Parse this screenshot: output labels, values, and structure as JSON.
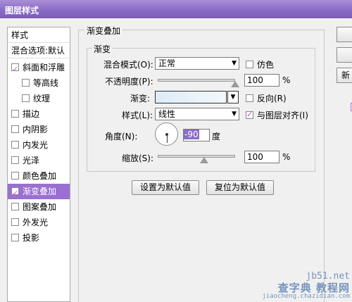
{
  "window": {
    "title": "图层样式"
  },
  "sidebar": {
    "items": [
      {
        "label": "样式",
        "type": "header"
      },
      {
        "label": "混合选项:默认",
        "type": "header"
      },
      {
        "label": "斜面和浮雕",
        "checked": true
      },
      {
        "label": "等高线",
        "checked": false,
        "indent": true
      },
      {
        "label": "纹理",
        "checked": false,
        "indent": true
      },
      {
        "label": "描边",
        "checked": false
      },
      {
        "label": "内阴影",
        "checked": false
      },
      {
        "label": "内发光",
        "checked": false
      },
      {
        "label": "光泽",
        "checked": false
      },
      {
        "label": "颜色叠加",
        "checked": false
      },
      {
        "label": "渐变叠加",
        "checked": true,
        "selected": true
      },
      {
        "label": "图案叠加",
        "checked": false
      },
      {
        "label": "外发光",
        "checked": false
      },
      {
        "label": "投影",
        "checked": false
      }
    ]
  },
  "panel": {
    "title": "渐变叠加",
    "group_title": "渐变",
    "blend_mode": {
      "label": "混合模式(O):",
      "value": "正常"
    },
    "dither": {
      "label": "仿色",
      "checked": false
    },
    "opacity": {
      "label": "不透明度(P):",
      "value": "100",
      "unit": "%",
      "level": 1.0
    },
    "gradient": {
      "label": "渐变:"
    },
    "reverse": {
      "label": "反向(R)",
      "checked": false
    },
    "style": {
      "label": "样式(L):",
      "value": "线性"
    },
    "align_layer": {
      "label": "与图层对齐(I)",
      "checked": true
    },
    "angle": {
      "label": "角度(N):",
      "value": "-90",
      "unit": "度"
    },
    "scale": {
      "label": "缩放(S):",
      "value": "100",
      "unit": "%",
      "level": 0.5
    },
    "buttons": {
      "set_default": "设置为默认值",
      "reset_default": "复位为默认值"
    }
  },
  "right_buttons": {
    "new_style_partial": "新"
  },
  "watermark": {
    "line1": "jb51.net",
    "line2": "查字典 教程网",
    "line3": "jiaocheng.chazidian.com"
  },
  "colors": {
    "title_bar": "#8a6cc4",
    "selected_item": "#9b6fd1",
    "checkmark": "#c060c0"
  }
}
